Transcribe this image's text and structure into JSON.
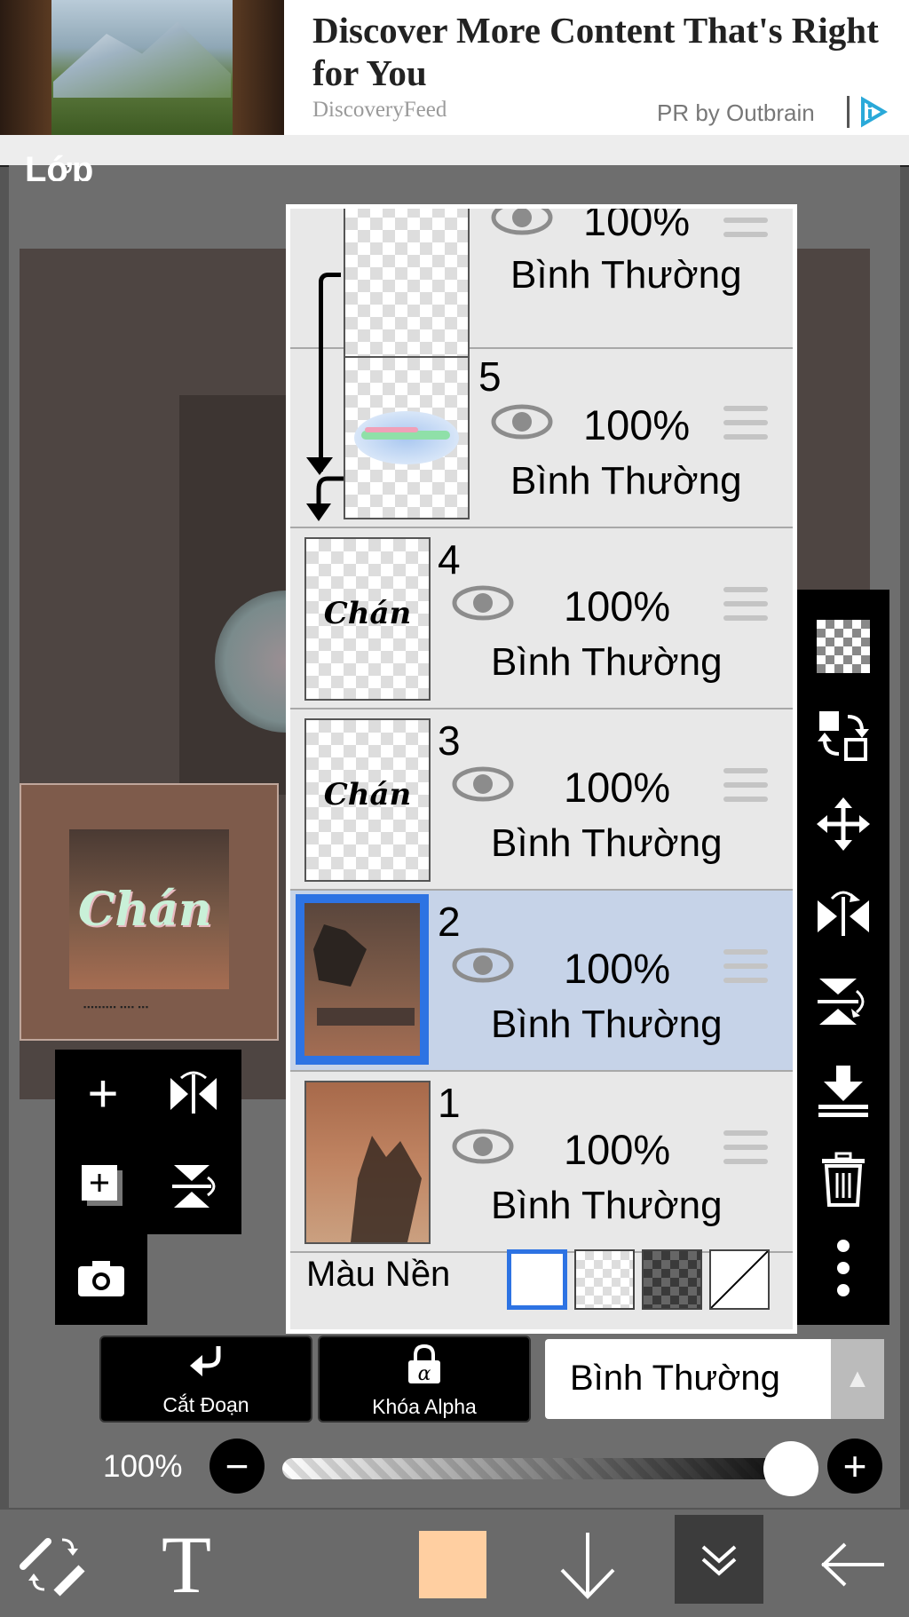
{
  "ad": {
    "headline": "Discover More Content That's Right for You",
    "source": "DiscoveryFeed",
    "sponsor": "PR by Outbrain"
  },
  "panel": {
    "title": "Lớp"
  },
  "layers": [
    {
      "number": "",
      "opacity": "100%",
      "blend": "Bình Thường"
    },
    {
      "number": "5",
      "opacity": "100%",
      "blend": "Bình Thường"
    },
    {
      "number": "4",
      "opacity": "100%",
      "blend": "Bình Thường",
      "thumb_text": "Chán"
    },
    {
      "number": "3",
      "opacity": "100%",
      "blend": "Bình Thường",
      "thumb_text": "Chán"
    },
    {
      "number": "2",
      "opacity": "100%",
      "blend": "Bình Thường",
      "selected": true
    },
    {
      "number": "1",
      "opacity": "100%",
      "blend": "Bình Thường"
    }
  ],
  "background": {
    "label": "Màu Nền",
    "options": [
      "white",
      "checker-light",
      "checker-dark",
      "none"
    ],
    "selected": "white"
  },
  "preview": {
    "word": "Chán"
  },
  "controls": {
    "clipping_label": "Cắt Đoạn",
    "alpha_lock_label": "Khóa Alpha",
    "blend_mode": "Bình Thường",
    "opacity": "100%"
  },
  "colors": {
    "current_color": "#FFCFA1",
    "selection": "#C6D3E8",
    "accent": "#2D73E3"
  },
  "icons": {
    "left_tools": [
      "plus-icon",
      "flip-horizontal-icon",
      "add-layer-icon",
      "flip-vertical-icon",
      "camera-icon"
    ],
    "right_tools": [
      "checker-icon",
      "swap-icon",
      "move-icon",
      "flip-h-icon",
      "flip-v-icon",
      "merge-down-icon",
      "trash-icon",
      "more-icon"
    ],
    "bottom_bar": [
      "brush-eraser-icon",
      "text-tool-icon",
      "color-swatch",
      "arrow-down-icon",
      "double-chevron-icon",
      "back-arrow-icon"
    ]
  }
}
